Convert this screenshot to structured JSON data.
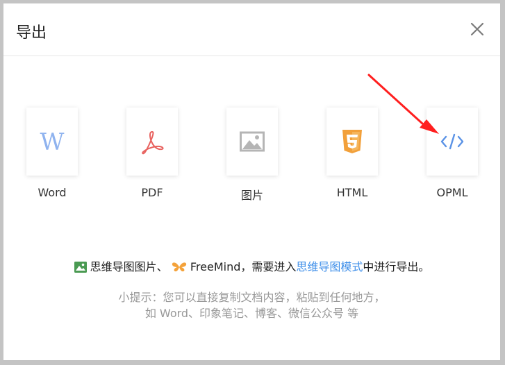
{
  "dialog": {
    "title": "导出"
  },
  "options": [
    {
      "label": "Word",
      "icon": "word-icon"
    },
    {
      "label": "PDF",
      "icon": "pdf-icon"
    },
    {
      "label": "图片",
      "icon": "image-icon"
    },
    {
      "label": "HTML",
      "icon": "html5-icon"
    },
    {
      "label": "OPML",
      "icon": "code-icon"
    }
  ],
  "info": {
    "part1": "思维导图图片、",
    "part2": "FreeMind，需要进入",
    "link": "思维导图模式",
    "part3": "中进行导出。"
  },
  "tip": {
    "line1": "小提示：您可以直接复制文档内容，粘贴到任何地方，",
    "line2": "如 Word、印象笔记、博客、微信公众号 等"
  },
  "colors": {
    "word": "#8fb3ef",
    "pdf": "#e8625f",
    "image": "#b5b5b5",
    "html": "#f2a03a",
    "opml": "#5b93e6",
    "link": "#3d8ee9",
    "arrow": "#ff1f1f"
  }
}
